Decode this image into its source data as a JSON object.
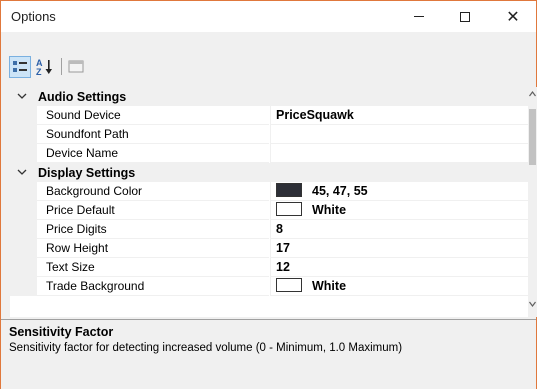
{
  "window": {
    "title": "Options"
  },
  "categories": [
    {
      "label": "Audio Settings",
      "properties": [
        {
          "name": "Sound Device",
          "value": "PriceSquawk"
        },
        {
          "name": "Soundfont Path",
          "value": ""
        },
        {
          "name": "Device Name",
          "value": ""
        }
      ]
    },
    {
      "label": "Display Settings",
      "properties": [
        {
          "name": "Background Color",
          "value": "45, 47, 55",
          "swatch": "#2d2f37"
        },
        {
          "name": "Price Default",
          "value": "White",
          "swatch": "#ffffff"
        },
        {
          "name": "Price Digits",
          "value": "8"
        },
        {
          "name": "Row Height",
          "value": "17"
        },
        {
          "name": "Text Size",
          "value": "12"
        },
        {
          "name": "Trade Background",
          "value": "White",
          "swatch": "#ffffff"
        }
      ]
    }
  ],
  "help": {
    "title": "Sensitivity Factor",
    "description": "Sensitivity factor for detecting increased volume (0 - Minimum, 1.0 Maximum)"
  },
  "toolbar": {
    "categorized_icon": "categorized-icon",
    "alphabetical_icon": "alphabetical-sort-icon",
    "property_pages_icon": "property-pages-icon"
  },
  "colors": {
    "window_border": "#e0783c",
    "categorized_active": "#cce4f7"
  }
}
